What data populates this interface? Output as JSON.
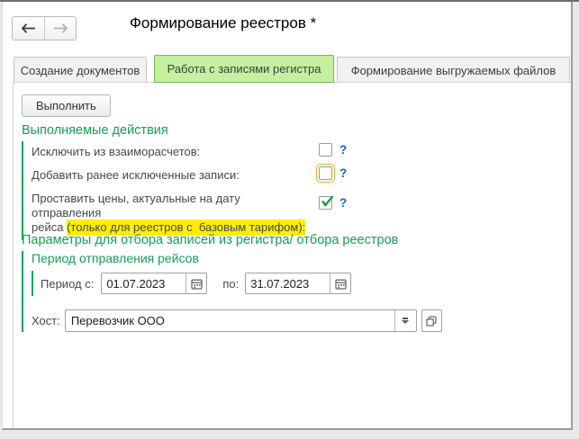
{
  "window": {
    "title": "Формирование реестров *"
  },
  "nav": {
    "back_name": "arrow-left",
    "forward_name": "arrow-right",
    "forward_disabled": true
  },
  "tabs": [
    {
      "label": "Создание документов",
      "active": false
    },
    {
      "label": "Работа с записями регистра",
      "active": true
    },
    {
      "label": "Формирование выгружаемых файлов",
      "active": false
    }
  ],
  "toolbar": {
    "execute_label": "Выполнить"
  },
  "actions": {
    "heading": "Выполняемые действия",
    "help_label": "?",
    "rows": [
      {
        "label": "Исключить из взаиморасчетов:",
        "checked": false,
        "focused": false
      },
      {
        "label": "Добавить ранее исключенные записи:",
        "checked": false,
        "focused": true
      },
      {
        "label_line1": "Проставить цены, актуальные на дату отправления",
        "label_line2_prefix": "рейса ",
        "label_line2_highlight": "(только для реестров с  базовым тарифом):",
        "checked": true,
        "focused": false
      }
    ]
  },
  "filters": {
    "heading": "Параметры для отбора записей из регистра/ отбора реестров",
    "period_group": {
      "heading": "Период отправления рейсов",
      "from_label": "Период с:",
      "from_value": "01.07.2023",
      "to_label": "по:",
      "to_value": "31.07.2023"
    },
    "host": {
      "label": "Хост:",
      "value": "Перевозчик ООО"
    }
  },
  "icons": {
    "back": "arrow-left",
    "forward": "arrow-right",
    "calendar": "calendar-grid",
    "dropdown": "combo-arrow-down",
    "open": "overlapping-squares",
    "check": "checkmark"
  },
  "colors": {
    "heading_green": "#14a054",
    "group_bar_green": "#18a257",
    "active_tab_bg": "#c4f0a0",
    "active_tab_border": "#77b74e",
    "highlight_yellow": "#ffee00",
    "focus_ring_gold": "#e2b118",
    "help_blue": "#1565b8",
    "check_green": "#1c9b3a",
    "label_gray": "#45484a",
    "window_border": "#9b9b9b"
  }
}
